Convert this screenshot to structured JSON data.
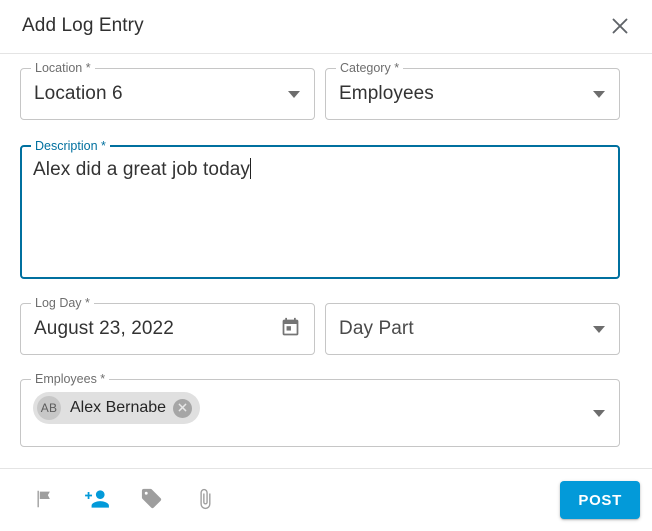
{
  "header": {
    "title": "Add Log Entry",
    "close_icon": "close-icon"
  },
  "form": {
    "location": {
      "label": "Location *",
      "value": "Location 6",
      "icon": "chevron-down-icon"
    },
    "category": {
      "label": "Category *",
      "value": "Employees",
      "icon": "chevron-down-icon"
    },
    "description": {
      "label": "Description *",
      "value": "Alex did a great job today",
      "focused": true
    },
    "log_day": {
      "label": "Log Day *",
      "value": "August 23, 2022",
      "icon": "calendar-icon"
    },
    "day_part": {
      "label": "",
      "value": "Day Part",
      "icon": "chevron-down-icon"
    },
    "employees": {
      "label": "Employees *",
      "icon": "chevron-down-icon",
      "chips": [
        {
          "initials": "AB",
          "name": "Alex Bernabe",
          "remove_icon": "cancel-icon"
        }
      ]
    }
  },
  "footer": {
    "icons": [
      {
        "name": "flag-icon",
        "label": "Flag",
        "active": false
      },
      {
        "name": "person-add-icon",
        "label": "Add Employee",
        "active": true
      },
      {
        "name": "tag-icon",
        "label": "Tag",
        "active": false
      },
      {
        "name": "attachment-icon",
        "label": "Attach File",
        "active": false
      }
    ],
    "post_label": "POST"
  },
  "colors": {
    "accent": "#039ad9",
    "focus": "#00709f",
    "icon_gray": "#9e9e9e",
    "border": "#c6c6c6"
  }
}
